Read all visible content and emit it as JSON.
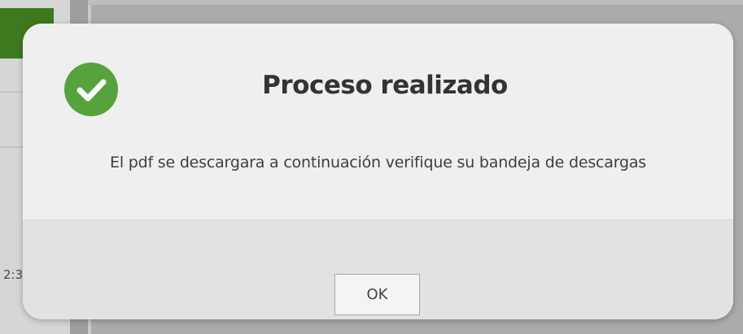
{
  "background": {
    "left_fragment_text": "2:3"
  },
  "dialog": {
    "icon": "check-circle-icon",
    "icon_color": "#56a33c",
    "title": "Proceso realizado",
    "message": "El pdf se descargara a continuación verifique su bandeja de descargas",
    "ok_label": "OK"
  }
}
